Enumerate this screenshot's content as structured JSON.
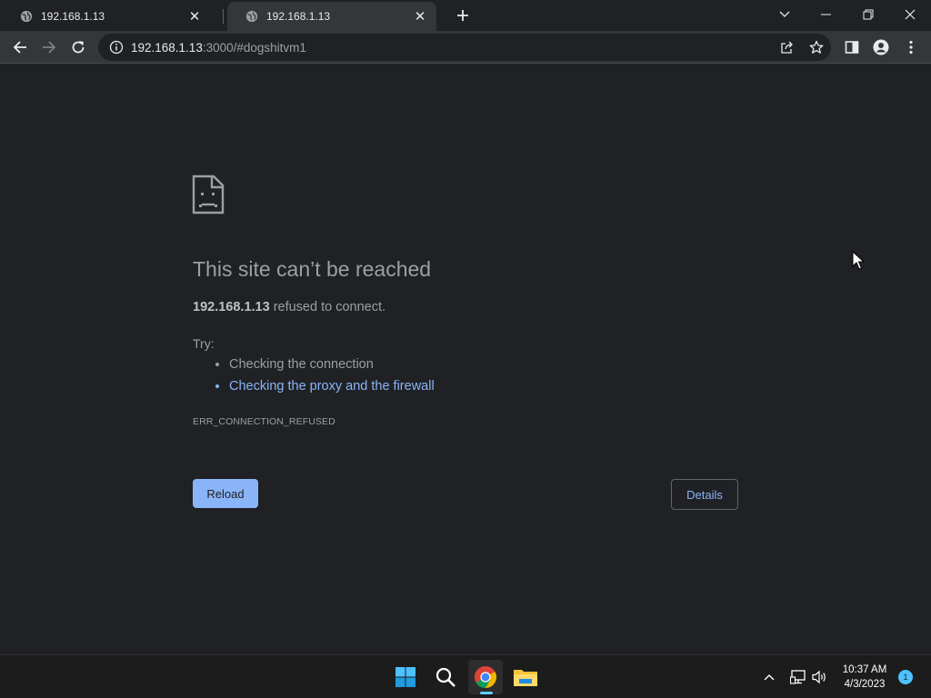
{
  "browser": {
    "tabs": [
      {
        "title": "192.168.1.13",
        "active": false
      },
      {
        "title": "192.168.1.13",
        "active": true
      }
    ],
    "icons": {
      "new_tab": "plus-icon",
      "tab_search": "chevron-down-icon",
      "minimize": "minimize-icon",
      "restore": "restore-icon",
      "close": "close-icon"
    }
  },
  "toolbar": {
    "url_host": "192.168.1.13",
    "url_rest": ":3000/#dogshitvm1",
    "icons": [
      "back-icon",
      "forward-icon",
      "reload-icon",
      "info-icon",
      "share-icon",
      "star-icon",
      "side-panel-icon",
      "profile-icon",
      "menu-icon"
    ]
  },
  "error_page": {
    "title": "This site can’t be reached",
    "host": "192.168.1.13",
    "summary_rest": " refused to connect.",
    "try_label": "Try:",
    "suggestions": [
      {
        "text": "Checking the connection",
        "is_link": false
      },
      {
        "text": "Checking the proxy and the firewall",
        "is_link": true
      }
    ],
    "error_code": "ERR_CONNECTION_REFUSED",
    "reload_label": "Reload",
    "details_label": "Details"
  },
  "taskbar": {
    "time": "10:37 AM",
    "date": "4/3/2023",
    "notification_count": "1",
    "apps": [
      "windows-start-icon",
      "search-icon",
      "chrome-icon",
      "file-explorer-icon"
    ],
    "tray": [
      "chevron-up-icon",
      "network-icon",
      "volume-icon"
    ]
  },
  "colors": {
    "background": "#202124",
    "toolbar": "#35363a",
    "accent_blue": "#8ab4f8",
    "text_muted": "#9aa0a6",
    "taskbar": "#1c1c1c"
  }
}
